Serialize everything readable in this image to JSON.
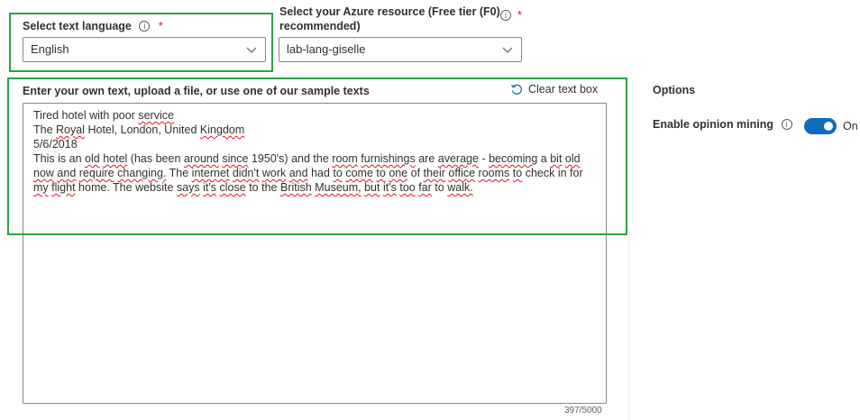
{
  "language": {
    "label": "Select text language",
    "required_mark": "*",
    "selected": "English"
  },
  "resource": {
    "label_line1": "Select your Azure resource (Free tier (F0)",
    "label_line2": "recommended)",
    "required_mark": "*",
    "selected": "lab-lang-giselle"
  },
  "input": {
    "label": "Enter your own text, upload a file, or use one of our sample texts",
    "clear_label": "Clear text box",
    "char_count": "397/5000",
    "lines": [
      "Tired hotel with poor service",
      "The Royal Hotel, London, United Kingdom",
      "5/6/2018",
      "This is an old hotel (has been around since 1950's) and the room furnishings are average - becoming a bit old",
      "now and require changing. The internet didn't work and had to come to one of their office rooms to check in for",
      "my flight home. The website says it's close to the British Museum, but it's too far to walk."
    ]
  },
  "options": {
    "title": "Options",
    "opinion_mining_label": "Enable opinion mining",
    "toggle_state": "On",
    "toggle_on": true,
    "accent_color": "#0f6cbd"
  },
  "icons": {
    "info": "info-icon",
    "chevron": "chevron-down-icon",
    "refresh": "refresh-icon"
  },
  "highlight_color": "#2ea043"
}
